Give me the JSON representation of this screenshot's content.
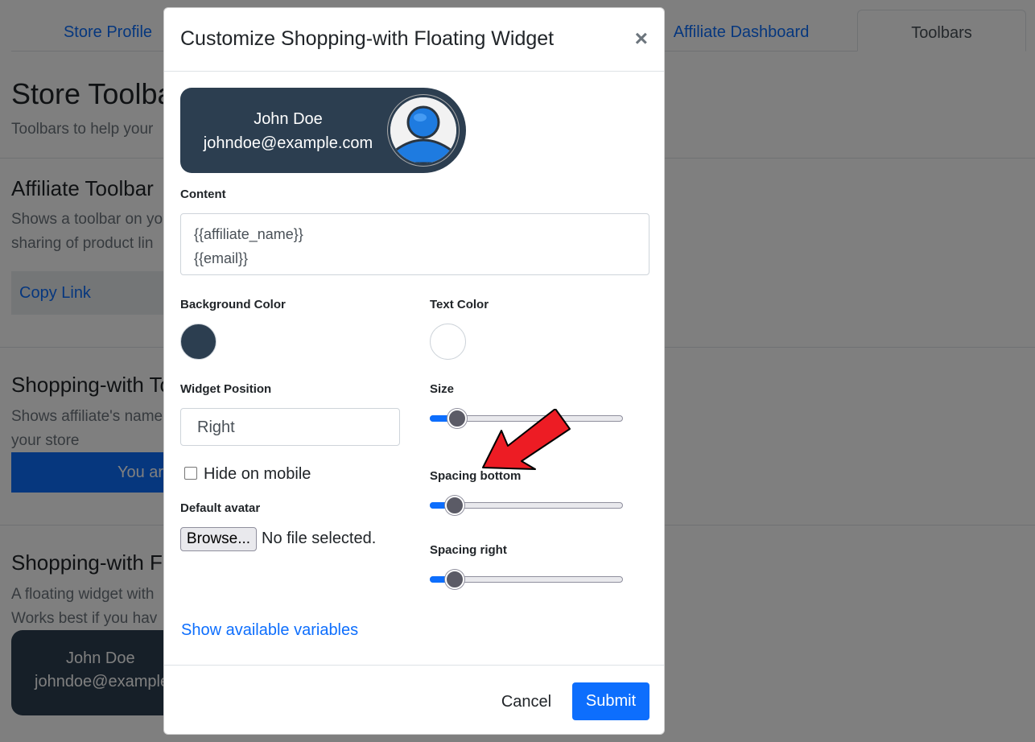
{
  "background": {
    "tabs": [
      "Store Profile",
      "Affiliate Dashboard",
      "Toolbars"
    ],
    "page_title": "Store Toolbars",
    "page_subtitle": "Toolbars to help your",
    "sections": [
      {
        "title": "Affiliate Toolbar",
        "desc1": "Shows a toolbar on yo",
        "desc2": "sharing of product lin",
        "button": "Copy Link"
      },
      {
        "title": "Shopping-with Toolbar",
        "desc1": "Shows affiliate's name",
        "desc2": "your store",
        "bar_text": "You are"
      },
      {
        "title": "Shopping-with Floating Widget",
        "desc1": "A floating widget with",
        "desc2": "Works best if you hav"
      }
    ],
    "widget_name": "John Doe",
    "widget_email": "johndoe@example.com"
  },
  "modal": {
    "title": "Customize Shopping-with Floating Widget",
    "close_label": "×",
    "preview": {
      "name": "John Doe",
      "email": "johndoe@example.com"
    },
    "content_label": "Content",
    "content_lines": [
      "{{affiliate_name}}",
      "{{email}}"
    ],
    "background_color_label": "Background Color",
    "background_color": "#2c3e50",
    "text_color_label": "Text Color",
    "text_color": "#ffffff",
    "widget_position_label": "Widget Position",
    "widget_position_value": "Right",
    "size_label": "Size",
    "size_value": 0.1,
    "hide_on_mobile_label": "Hide on mobile",
    "hide_on_mobile_checked": false,
    "spacing_bottom_label": "Spacing bottom",
    "spacing_bottom_value": 0.09,
    "default_avatar_label": "Default avatar",
    "browse_label": "Browse...",
    "file_status": "No file selected.",
    "spacing_right_label": "Spacing right",
    "spacing_right_value": 0.09,
    "show_variables_label": "Show available variables",
    "cancel_label": "Cancel",
    "submit_label": "Submit"
  },
  "colors": {
    "accent": "#0d6efd",
    "annotation_arrow": "#ed1c24"
  }
}
